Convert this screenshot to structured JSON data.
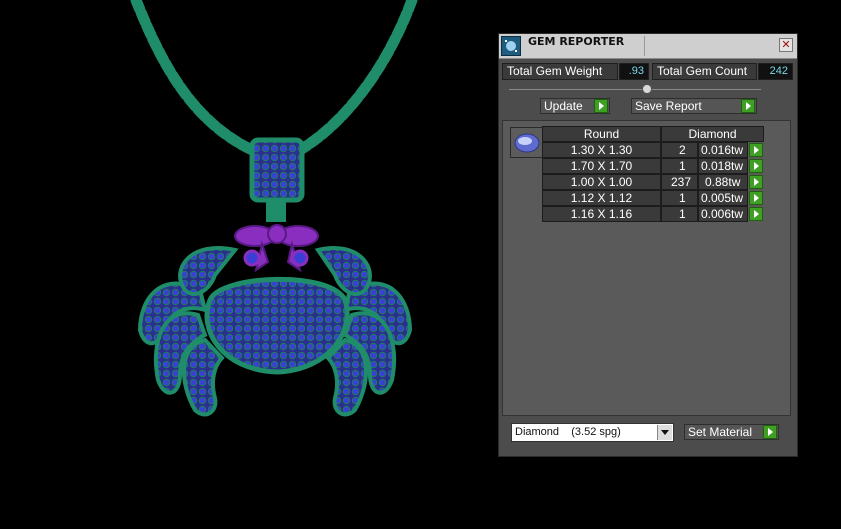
{
  "viewport": {
    "model": "crab-pendant-on-chain"
  },
  "panel": {
    "title": "GEM REPORTER",
    "icon": "gem-reporter-icon",
    "close_glyph": "✕",
    "total_weight_label": "Total Gem Weight",
    "total_weight_value": ".93",
    "total_count_label": "Total Gem Count",
    "total_count_value": "242",
    "update_label": "Update",
    "save_label": "Save Report",
    "table": {
      "shape_header": "Round",
      "material_header": "Diamond",
      "rows": [
        {
          "size": "1.30 X 1.30",
          "count": "2",
          "weight": "0.016tw"
        },
        {
          "size": "1.70 X 1.70",
          "count": "1",
          "weight": "0.018tw"
        },
        {
          "size": "1.00 X 1.00",
          "count": "237",
          "weight": "0.88tw"
        },
        {
          "size": "1.12 X 1.12",
          "count": "1",
          "weight": "0.005tw"
        },
        {
          "size": "1.16 X 1.16",
          "count": "1",
          "weight": "0.006tw"
        }
      ]
    },
    "material_select": "Diamond    (3.52 spg)",
    "set_material_label": "Set Material"
  },
  "colors": {
    "metal_green": "#1f8c6a",
    "gem_blue": "#3a3ad0",
    "purple": "#8a2ec0",
    "accent_green": "#3f9f24",
    "value_cyan": "#7ad8e8"
  }
}
